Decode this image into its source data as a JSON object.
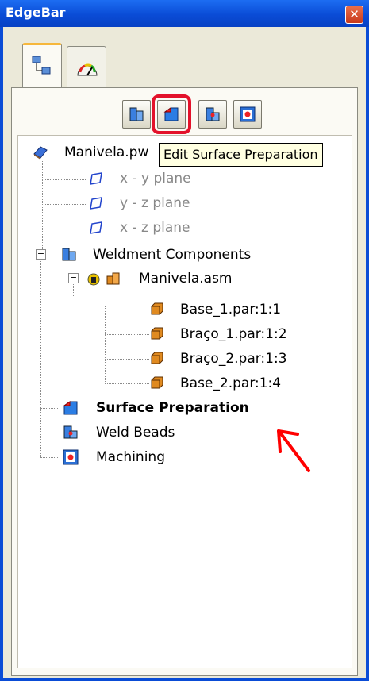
{
  "window": {
    "title": "EdgeBar",
    "close_symbol": "✕"
  },
  "tabs": [
    {
      "name": "tab-pathfinder",
      "icon": "pathfinder-tree-icon"
    },
    {
      "name": "tab-gauge",
      "icon": "gauge-icon"
    }
  ],
  "toolbar": {
    "buttons": [
      {
        "name": "weldment-components-button",
        "icon": "weldment-components-icon"
      },
      {
        "name": "edit-surface-preparation-button",
        "icon": "surface-preparation-icon",
        "highlighted": true
      },
      {
        "name": "weld-beads-button",
        "icon": "weld-beads-icon"
      },
      {
        "name": "machining-button",
        "icon": "machining-icon"
      }
    ],
    "tooltip": "Edit Surface Preparation"
  },
  "tree": {
    "root": {
      "label": "Manivela.pw",
      "icon": "weldment-document-icon"
    },
    "planes": [
      {
        "label": "x - y plane",
        "icon": "plane-icon"
      },
      {
        "label": "y - z plane",
        "icon": "plane-icon"
      },
      {
        "label": "x - z plane",
        "icon": "plane-icon"
      }
    ],
    "weldment_components": {
      "label": "Weldment Components",
      "icon": "weldment-components-icon",
      "expander": "−"
    },
    "assembly": {
      "label": "Manivela.asm",
      "icon": "assembly-icon",
      "status_icon": "lock-status-icon",
      "expander": "−"
    },
    "parts": [
      {
        "label": "Base_1.par:1:1",
        "icon": "part-icon"
      },
      {
        "label": "Braço_1.par:1:2",
        "icon": "part-icon"
      },
      {
        "label": "Braço_2.par:1:3",
        "icon": "part-icon"
      },
      {
        "label": "Base_2.par:1:4",
        "icon": "part-icon"
      }
    ],
    "surface_preparation": {
      "label": "Surface Preparation",
      "icon": "surface-preparation-icon"
    },
    "weld_beads": {
      "label": "Weld Beads",
      "icon": "weld-beads-icon"
    },
    "machining": {
      "label": "Machining",
      "icon": "machining-icon"
    }
  },
  "annotation": {
    "icon": "red-arrow-icon",
    "color": "#ff0000"
  },
  "colors": {
    "titlebar": "#0a4cd6",
    "highlight": "#e3122b",
    "tooltip_bg": "#ffffe1"
  }
}
